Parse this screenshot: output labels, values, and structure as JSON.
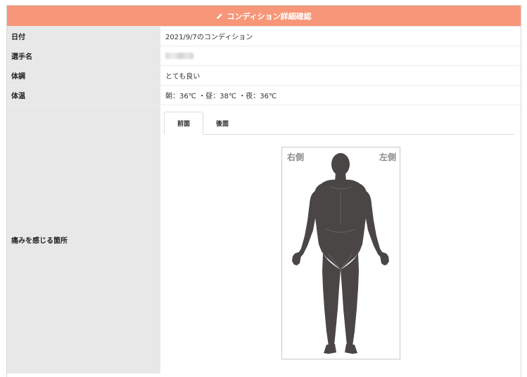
{
  "header": {
    "title": "コンディション詳細確認",
    "icon": "pencil-icon",
    "color": "#f79678"
  },
  "rows": {
    "date": {
      "label": "日付",
      "value": "2021/9/7のコンディション"
    },
    "player": {
      "label": "選手名"
    },
    "condition": {
      "label": "体調",
      "value": "とても良い"
    },
    "temperature": {
      "label": "体温",
      "value": "朝：36℃ ・昼：38℃ ・夜：36℃"
    },
    "pain": {
      "label": "痛みを感じる箇所"
    }
  },
  "tabs": [
    {
      "label": "前面",
      "active": true
    },
    {
      "label": "後面",
      "active": false
    }
  ],
  "figure": {
    "right_side": "右側",
    "left_side": "左側",
    "body_color": "#4a4646"
  }
}
